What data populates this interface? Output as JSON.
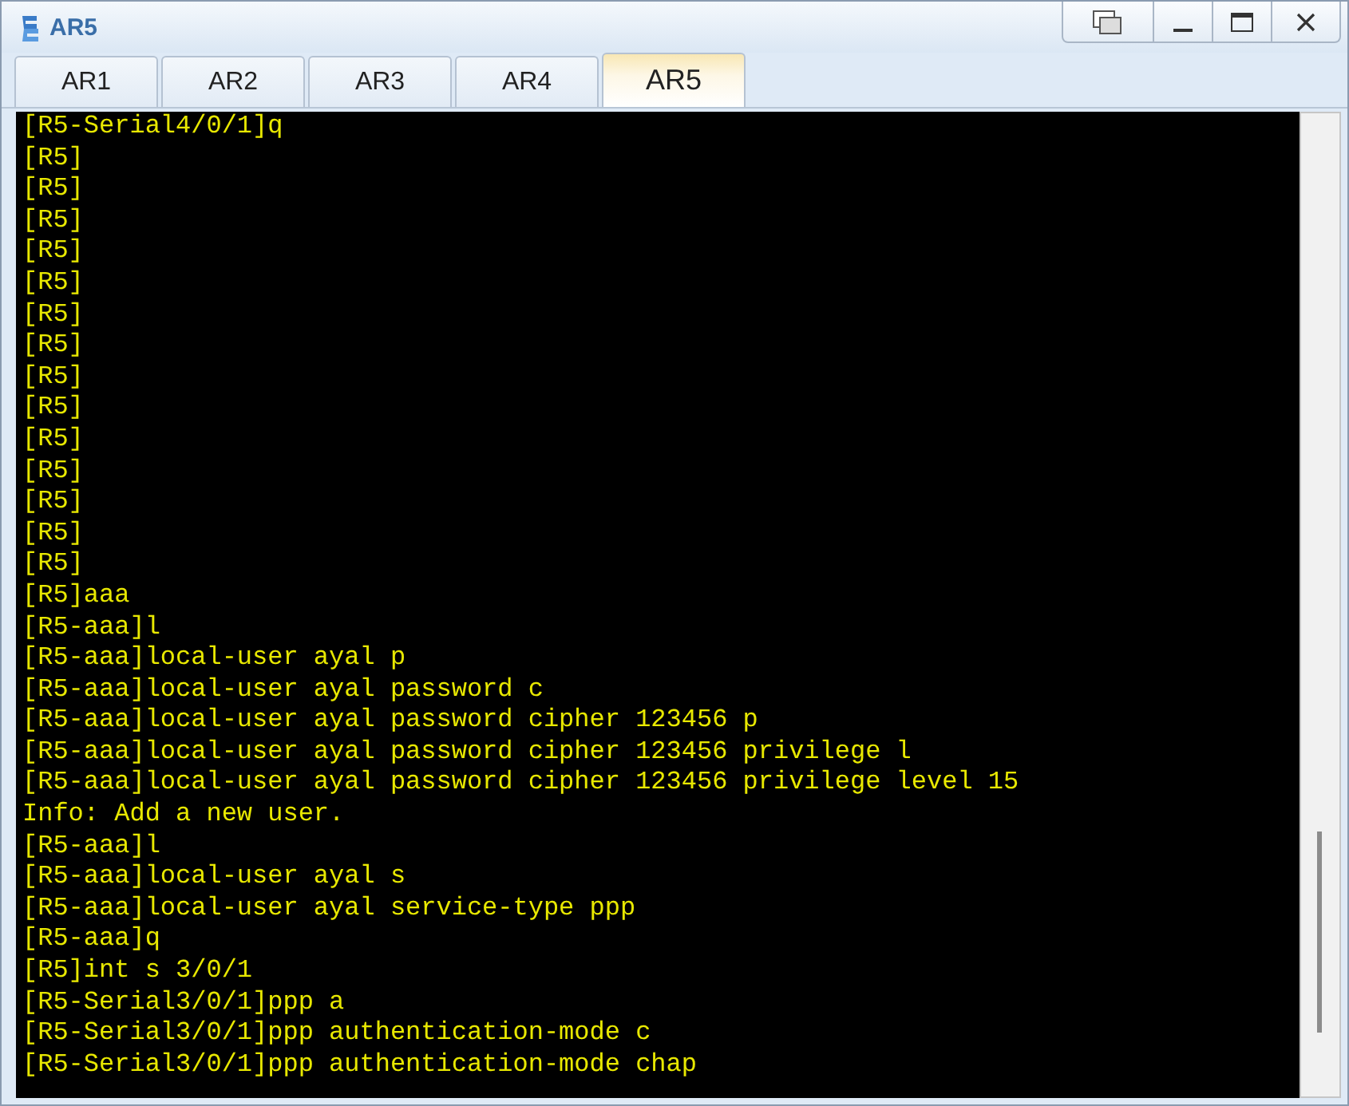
{
  "window": {
    "title": "AR5"
  },
  "tabs": [
    {
      "label": "AR1",
      "selected": false
    },
    {
      "label": "AR2",
      "selected": false
    },
    {
      "label": "AR3",
      "selected": false
    },
    {
      "label": "AR4",
      "selected": false
    },
    {
      "label": "AR5",
      "selected": true
    }
  ],
  "terminal": {
    "lines": [
      "[R5-Serial4/0/1]q",
      "[R5]",
      "[R5]",
      "[R5]",
      "[R5]",
      "[R5]",
      "[R5]",
      "[R5]",
      "[R5]",
      "[R5]",
      "[R5]",
      "[R5]",
      "[R5]",
      "[R5]",
      "[R5]",
      "[R5]aaa",
      "[R5-aaa]l",
      "[R5-aaa]local-user ayal p",
      "[R5-aaa]local-user ayal password c",
      "[R5-aaa]local-user ayal password cipher 123456 p",
      "[R5-aaa]local-user ayal password cipher 123456 privilege l",
      "[R5-aaa]local-user ayal password cipher 123456 privilege level 15",
      "Info: Add a new user.",
      "[R5-aaa]l",
      "[R5-aaa]local-user ayal s",
      "[R5-aaa]local-user ayal service-type ppp",
      "[R5-aaa]q",
      "[R5]int s 3/0/1",
      "[R5-Serial3/0/1]ppp a",
      "[R5-Serial3/0/1]ppp authentication-mode c",
      "[R5-Serial3/0/1]ppp authentication-mode chap"
    ]
  }
}
